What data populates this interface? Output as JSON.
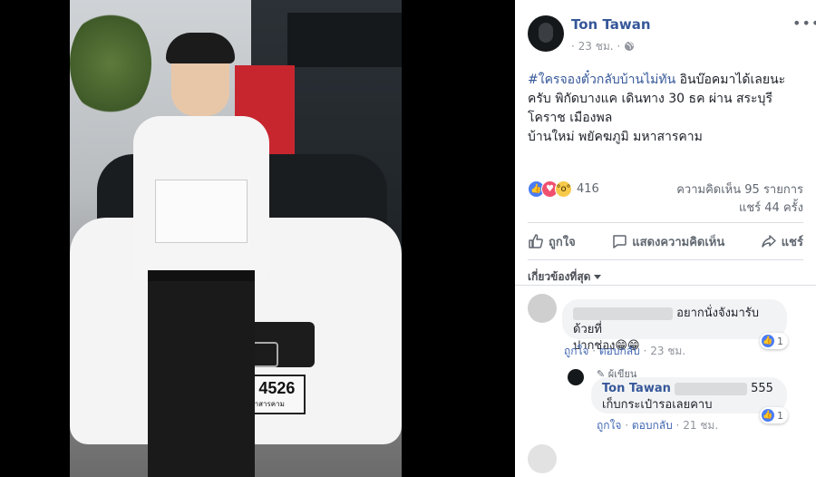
{
  "post": {
    "author": "Ton Tawan",
    "time": "23 ชม.",
    "meta_separator": "·",
    "hashtag": "#ใครจองตั๋วกลับบ้านไม่ทัน",
    "text_after_hashtag": " อินบ๊อคมาได้เลยนะครับ พิกัดบางแค เดินทาง 30 ธค ผ่าน สระบุรี โคราช เมืองพล",
    "text_line2": "บ้านใหม่ พยัคฆภูมิ มหาสารคาม"
  },
  "stats": {
    "reactions_count": "416",
    "comments": "ความคิดเห็น 95 รายการ",
    "shares": "แชร์ 44 ครั้ง"
  },
  "actions": {
    "like": "ถูกใจ",
    "comment": "แสดงความคิดเห็น",
    "share": "แชร์"
  },
  "filter": {
    "label": "เกี่ยวข้องที่สุด"
  },
  "comments": [
    {
      "text_line1": "อยากนั่งจังมารับด้วยที่",
      "text_line2": "ปากช่อง",
      "emoji": "😁😁",
      "like_label": "ถูกใจ",
      "reply_label": "ตอบกลับ",
      "time": "23 ชม.",
      "likes": "1"
    }
  ],
  "reply": {
    "badge": "ผู้เขียน",
    "author": "Ton Tawan",
    "tail": "555",
    "text": "เก็บกระเป๋ารอเลยคาบ",
    "like_label": "ถูกใจ",
    "reply_label": "ตอบกลับ",
    "time": "21 ชม.",
    "likes": "1"
  },
  "photo": {
    "plate_number": "กก 4526",
    "plate_province": "มหาสารคาม"
  },
  "colors": {
    "link_blue": "#365899",
    "like_blue": "#4a7cf5",
    "love_red": "#f0506e",
    "wow_yellow": "#f7c94a"
  }
}
